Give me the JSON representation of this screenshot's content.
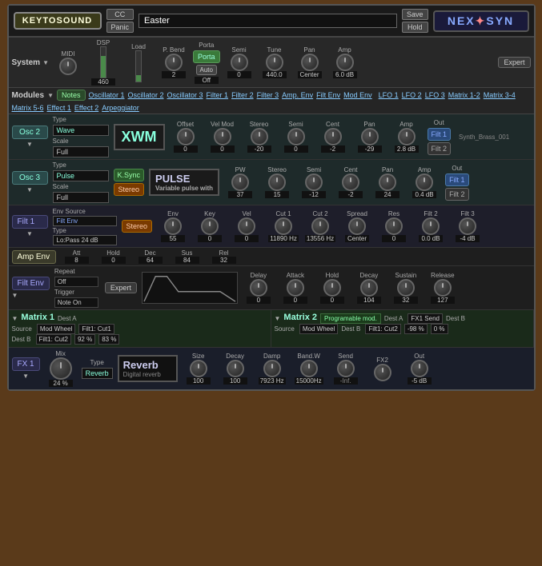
{
  "topbar": {
    "logo_kts": "KEYTOSOUND",
    "cc_label": "CC",
    "panic_label": "Panic",
    "preset_value": "Easter",
    "save_label": "Save",
    "hold_label": "Hold",
    "logo_nexsyn": "NEX✦SYN"
  },
  "system": {
    "label": "System",
    "midi_label": "MIDI",
    "dsp_label": "DSP",
    "load_label": "Load",
    "pbend_label": "P. Bend",
    "porta_label": "Porta",
    "auto_label": "Auto",
    "porta_off": "Off",
    "semi_label": "Semi",
    "tune_label": "Tune",
    "tune_value": "440.0",
    "pan_label": "Pan",
    "pan_value": "Center",
    "amp_label": "Amp",
    "amp_value": "6.0 dB",
    "pbend_value": "2",
    "val_460": "460",
    "expert_label": "Expert"
  },
  "modules": {
    "label": "Modules",
    "notes_label": "Notes",
    "items": [
      "Oscillator 1",
      "Oscillator 2",
      "Oscillator 3",
      "Filter 1",
      "Filter 2",
      "Filter 3",
      "Amp. Env",
      "Filt Env",
      "Mod Env",
      "LFO 1",
      "LFO 2",
      "LFO 3",
      "Matrix 1-2",
      "Matrix 3-4",
      "Matrix 5-6",
      "Effect 1",
      "Effect 2",
      "Arpeggiator"
    ]
  },
  "osc2": {
    "label": "Osc 2",
    "type_label": "Type",
    "type_value": "Wave",
    "scale_label": "Scale",
    "scale_value": "Full",
    "waveform": "XWM",
    "preset": "Synth_Brass_001",
    "offset_label": "Offset",
    "offset_value": "0",
    "velmod_label": "Vel Mod",
    "velmod_value": "0",
    "stereo_label": "Stereo",
    "semi_label": "Semi",
    "cent_label": "Cent",
    "cent_value": "-2",
    "pan_label": "Pan",
    "pan_value": "-29",
    "amp_label": "Amp",
    "amp_value": "2.8 dB",
    "out_label": "Out",
    "filt1_label": "Filt 1",
    "filt2_label": "Filt 2",
    "stereo_value": "-20"
  },
  "osc3": {
    "label": "Osc 3",
    "type_label": "Type",
    "type_value": "Pulse",
    "waveform": "PULSE",
    "waveform_sub": "Variable pulse with",
    "scale_label": "Scale",
    "scale_value": "Full",
    "pw_label": "PW",
    "pw_value": "37",
    "stereo_label": "Stereo",
    "stereo_value": "15",
    "semi_label": "Semi",
    "semi_value": "-12",
    "cent_label": "Cent",
    "cent_value": "-2",
    "pan_label": "Pan",
    "pan_value": "24",
    "amp_label": "Amp",
    "amp_value": "0.4 dB",
    "out_label": "Out",
    "filt1_label": "Filt 1",
    "filt2_label": "Filt 2",
    "ksync_label": "K.Sync",
    "stereo2_label": "Stereo"
  },
  "filt1": {
    "label": "Filt 1",
    "env_source_label": "Env Source",
    "env_source_value": "Filt Env",
    "type_label": "Type",
    "type_value": "Lo:Pass 24 dB",
    "stereo_label": "Stereo",
    "env_label": "Env",
    "env_value": "55",
    "key_label": "Key",
    "key_value": "0",
    "vel_label": "Vel",
    "vel_value": "0",
    "cut1_label": "Cut 1",
    "cut1_value": "11890 Hz",
    "cut2_label": "Cut 2",
    "cut2_value": "13556 Hz",
    "spread_label": "Spread",
    "spread_value": "Center",
    "res_label": "Res",
    "res_value": "0",
    "filt2_label": "Filt 2",
    "filt2_value": "0.0 dB",
    "filt3_label": "Filt 3",
    "filt3_value": "-4 dB"
  },
  "ampenv": {
    "label": "Amp Env",
    "att_label": "Att",
    "att_value": "8",
    "hold_label": "Hold",
    "hold_value": "0",
    "dec_label": "Dec",
    "dec_value": "64",
    "sus_label": "Sus",
    "sus_value": "84",
    "rel_label": "Rel",
    "rel_value": "32"
  },
  "filtenv": {
    "label": "Filt Env",
    "repeat_label": "Repeat",
    "repeat_value": "Off",
    "trigger_label": "Trigger",
    "trigger_value": "Note On",
    "expert_label": "Expert",
    "delay_label": "Delay",
    "delay_value": "0",
    "attack_label": "Attack",
    "attack_value": "0",
    "hold_label": "Hold",
    "hold_value": "0",
    "decay_label": "Decay",
    "decay_value": "104",
    "sustain_label": "Sustain",
    "sustain_value": "32",
    "release_label": "Release",
    "release_value": "127"
  },
  "matrix": {
    "m1_label": "Matrix 1",
    "m2_label": "Matrix 2",
    "dest_a_label": "Dest A",
    "dest_b_label": "Dest B",
    "source_label": "Source",
    "m1_dest_a": "Filt1: Cut1",
    "m1_dest_b_a": "Dest A",
    "m1_dest_b_b": "Dest B",
    "m1_source": "Mod Wheel",
    "m1_dest_b": "Filt1: Cut2",
    "m1_val_a": "92 %",
    "m1_val_b": "83 %",
    "m2_prog_mod": "Programable mod.",
    "m2_dest_a": "FX1 Send",
    "m2_source": "Mod Wheel",
    "m2_dest_b": "Filt1: Cut2",
    "m2_val_a": "-98 %",
    "m2_val_b": "0 %"
  },
  "fx1": {
    "label": "FX 1",
    "dropdown_label": "▼",
    "mix_label": "Mix",
    "mix_value": "24 %",
    "type_label": "Type",
    "type_value": "Reverb",
    "reverb_title": "Reverb",
    "reverb_sub": "Digital reverb",
    "size_label": "Size",
    "size_value": "100",
    "decay_label": "Decay",
    "decay_value": "100",
    "damp_label": "Damp",
    "damp_value": "7923 Hz",
    "bandw_label": "Band.W",
    "bandw_value": "15000Hz",
    "send_label": "Send",
    "send_value": "-Inf.",
    "fx2_label": "FX2",
    "out_label": "Out",
    "out_value": "-5 dB"
  }
}
